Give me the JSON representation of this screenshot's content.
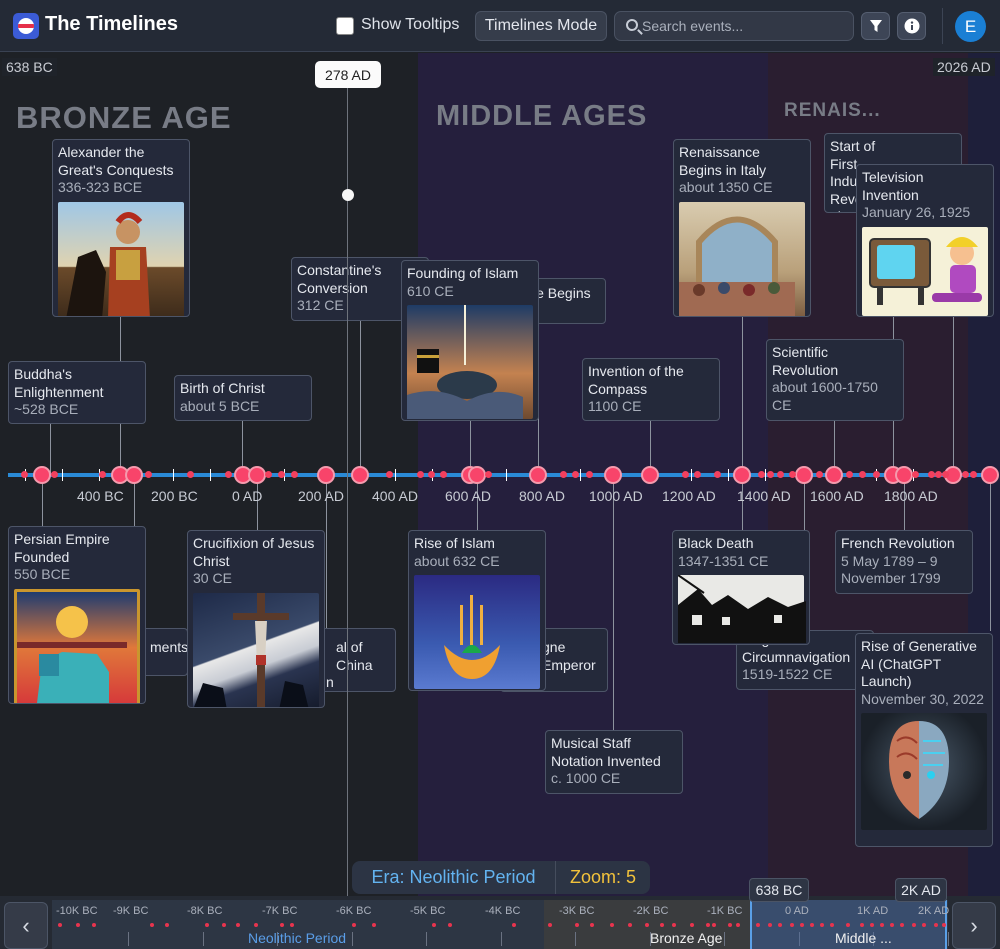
{
  "header": {
    "title": "The Timelines",
    "show_tooltips_label": "Show Tooltips",
    "mode_button": "Timelines Mode",
    "search_placeholder": "Search events...",
    "avatar_letter": "E"
  },
  "range": {
    "start": "638 BC",
    "end": "2026 AD",
    "cursor": "278 AD"
  },
  "eras": [
    "BRONZE AGE",
    "MIDDLE AGES",
    "RENAIS..."
  ],
  "axis_labels": [
    "400 BC",
    "200 BC",
    "0 AD",
    "200 AD",
    "400 AD",
    "600 AD",
    "800 AD",
    "1000 AD",
    "1200 AD",
    "1400 AD",
    "1600 AD",
    "1800 AD"
  ],
  "events": [
    {
      "title": "Alexander the Great's Conquests",
      "date": "336-323 BCE"
    },
    {
      "title": "Buddha's Enlightenment",
      "date": "~528 BCE"
    },
    {
      "title": "Birth of Christ",
      "date": "about 5 BCE"
    },
    {
      "title": "Constantine's Conversion",
      "date": "312 CE"
    },
    {
      "title": "Founding of Islam",
      "date": "610 CE"
    },
    {
      "title": "Viking Age Begins",
      "date": ""
    },
    {
      "title": "Invention of the Compass",
      "date": "1100 CE"
    },
    {
      "title": "Renaissance Begins in Italy",
      "date": "about 1350 CE"
    },
    {
      "title": "Start of First Industrial Revo",
      "date": "abo"
    },
    {
      "title": "Television Invention",
      "date": "January 26, 1925"
    },
    {
      "title": "Scientific Revolution",
      "date": "about 1600-1750 CE"
    },
    {
      "title": "Persian Empire Founded",
      "date": "550 BCE"
    },
    {
      "title": "Crucifixion of Jesus Christ",
      "date": "30 CE"
    },
    {
      "title": "Rise of Islam",
      "date": "about 632 CE"
    },
    {
      "title": "Black Death",
      "date": "1347-1351 CE"
    },
    {
      "title": "French Revolution",
      "date": "5 May 1789 – 9 November 1799"
    },
    {
      "title": "Rise of Generative AI (ChatGPT Launch)",
      "date": "November 30, 2022"
    },
    {
      "title": "Musical Staff Notation Invented",
      "date": "c. 1000 CE"
    },
    {
      "title": "Magellan's Circumnavigation",
      "date": "1519-1522 CE"
    }
  ],
  "hidden_fragments": [
    "ments",
    "al of China",
    "n",
    "gne",
    "Emperor"
  ],
  "footer": {
    "era_label": "Era: Neolithic Period",
    "zoom_label": "Zoom: 5"
  },
  "minimap": {
    "labels": [
      "-10K BC",
      "-9K BC",
      "-8K BC",
      "-7K BC",
      "-6K BC",
      "-5K BC",
      "-4K BC",
      "-3K BC",
      "-2K BC",
      "-1K BC",
      "0 AD",
      "1K AD",
      "2K AD"
    ],
    "eras": [
      "Neolithic Period",
      "Bronze Age",
      "Middle ..."
    ],
    "window_start": "638 BC",
    "window_end": "2K AD"
  },
  "colors": {
    "accent": "#2a8ad6",
    "event_point": "#f2405e",
    "era_label": "#63b3f0",
    "zoom_label": "#f2c23b"
  }
}
